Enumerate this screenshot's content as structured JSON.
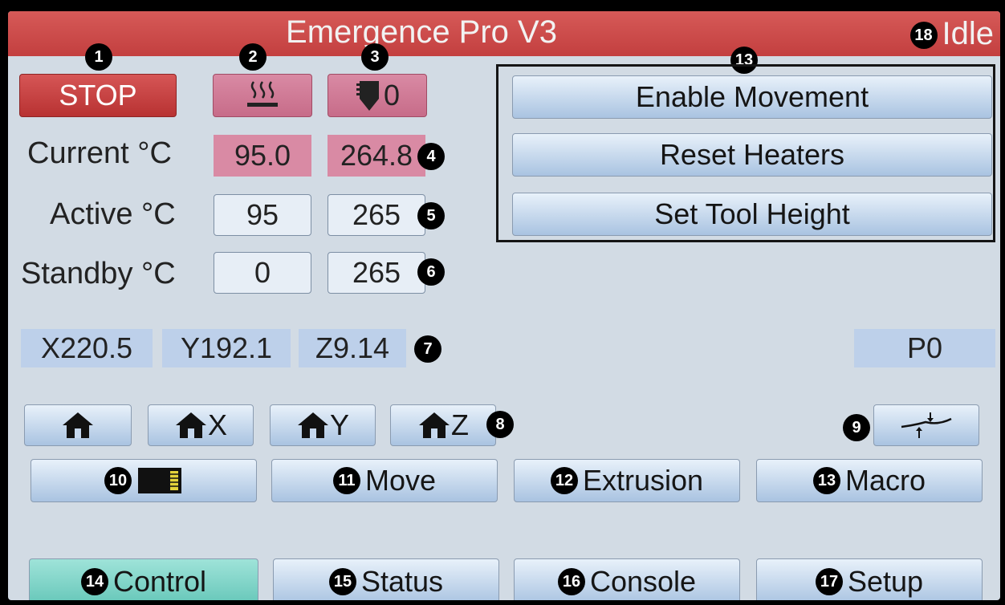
{
  "title": "Emergence Pro V3",
  "status": "Idle",
  "stop_label": "STOP",
  "heater_bed_icon": "heated-bed-icon",
  "tool_label": "0",
  "markers": [
    "1",
    "2",
    "3",
    "4",
    "5",
    "6",
    "7",
    "8",
    "9",
    "10",
    "11",
    "12",
    "13",
    "14",
    "15",
    "16",
    "17",
    "18"
  ],
  "temps": {
    "current_label": "Current °C",
    "active_label": "Active °C",
    "standby_label": "Standby °C",
    "bed_current": "95.0",
    "tool_current": "264.8",
    "bed_active": "95",
    "tool_active": "265",
    "bed_standby": "0",
    "tool_standby": "265"
  },
  "macros": [
    "Enable Movement",
    "Reset Heaters",
    "Set Tool Height"
  ],
  "position": {
    "x": "X220.5",
    "y": "Y192.1",
    "z": "Z9.14",
    "p": "P0"
  },
  "home": {
    "x": "X",
    "y": "Y",
    "z": "Z"
  },
  "mid_buttons": {
    "move": "Move",
    "extrusion": "Extrusion",
    "macro": "Macro"
  },
  "tabs": {
    "control": "Control",
    "status": "Status",
    "console": "Console",
    "setup": "Setup"
  },
  "colors": {
    "title_bar": "#c94848",
    "stop": "#c63b3b",
    "heater": "#d98aa4",
    "active_tab": "#7dd3c6",
    "button": "#b9cfe8"
  }
}
